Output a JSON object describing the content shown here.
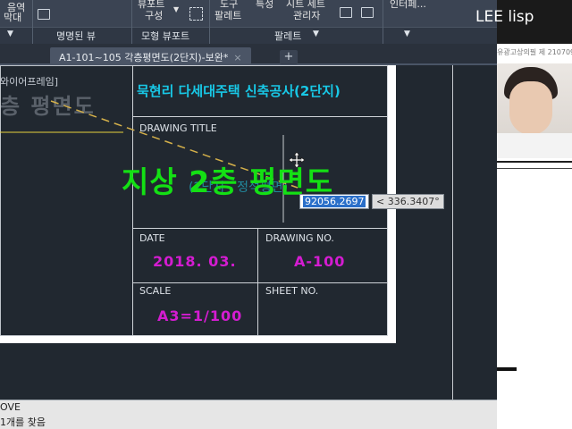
{
  "ribbon": {
    "partial_top_labels": [
      "음역",
      "막대",
      "뷰포트",
      "구성",
      "도구",
      "팔레트",
      "특성",
      "시트 세트",
      "관리자",
      "인터페..."
    ],
    "panels": [
      {
        "label": "",
        "dropdown": true
      },
      {
        "label": "명명된 뷰"
      },
      {
        "label": "모형 뷰포트"
      },
      {
        "label": "팔레트",
        "dropdown": true
      },
      {
        "label": "",
        "dropdown": true
      }
    ]
  },
  "tabs": [
    {
      "label": "A1-101~105 각층평면도(2단지)-보완*",
      "close": "×",
      "active": true
    }
  ],
  "new_tab_label": "+",
  "canvas": {
    "viewport_label": "와이어프레임]",
    "ghost_title": "층 평면도",
    "project_name": "묵현리 다세대주택 신축공사(2단지)",
    "drawing_title_label": "DRAWING TITLE",
    "drawing_title": "지상 2층 평면도",
    "drawing_subtitle": "(2단지 - 정석평면)",
    "date_label": "DATE",
    "date_value": "2018. 03.",
    "drawing_no_label": "DRAWING NO.",
    "drawing_no_value": "A-100",
    "scale_label": "SCALE",
    "scale_value": "A3=1/100",
    "sheet_no_label": "SHEET NO.",
    "coord_value": "92056.2697",
    "angle_value": "< 336.3407°"
  },
  "command": {
    "line1": "OVE",
    "line2": "1개를 찾음"
  },
  "overlay": {
    "channel_name": "LEE lisp",
    "cert_text": "유광고상의필 제 210709",
    "colors": {
      "accent_green": "#14e014",
      "magenta": "#d41cd1",
      "cyan": "#18c8e6"
    }
  }
}
